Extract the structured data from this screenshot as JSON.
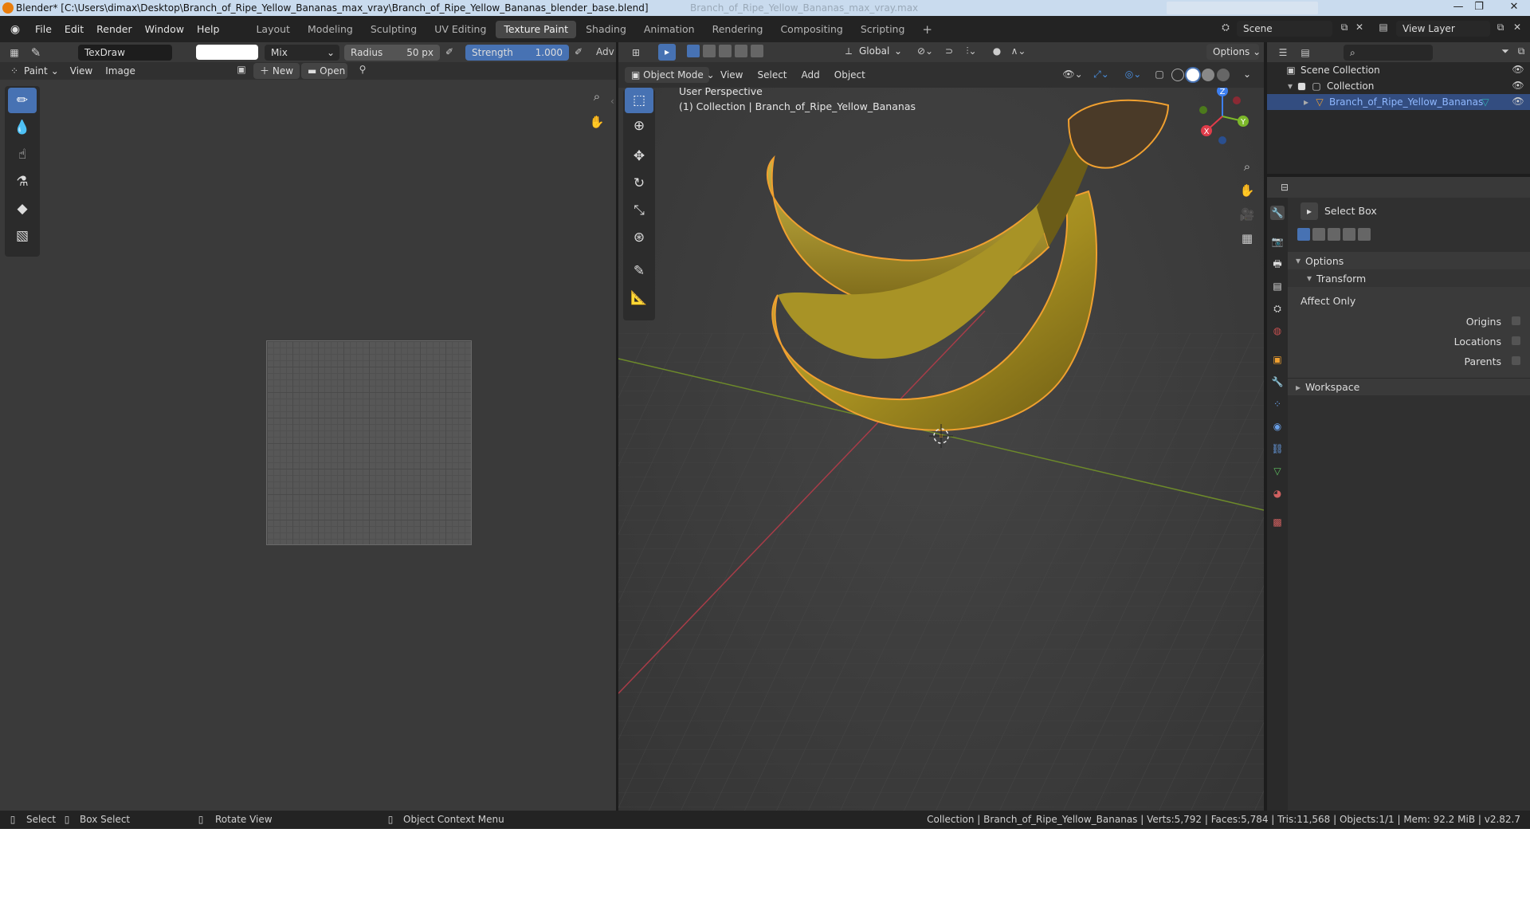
{
  "window": {
    "title": "Blender* [C:\\Users\\dimax\\Desktop\\Branch_of_Ripe_Yellow_Bananas_max_vray\\Branch_of_Ripe_Yellow_Bananas_blender_base.blend]",
    "ghost_text": "Branch_of_Ripe_Yellow_Bananas_max_vray.max"
  },
  "menu": [
    "File",
    "Edit",
    "Render",
    "Window",
    "Help"
  ],
  "workspaces": [
    {
      "label": "Layout"
    },
    {
      "label": "Modeling"
    },
    {
      "label": "Sculpting"
    },
    {
      "label": "UV Editing"
    },
    {
      "label": "Texture Paint",
      "active": true
    },
    {
      "label": "Shading"
    },
    {
      "label": "Animation"
    },
    {
      "label": "Rendering"
    },
    {
      "label": "Compositing"
    },
    {
      "label": "Scripting"
    }
  ],
  "add_workspace": "+",
  "scene": {
    "label": "Scene"
  },
  "view_layer": {
    "label": "View Layer"
  },
  "paint_header": {
    "brush_name": "TexDraw",
    "blend": "Mix",
    "radius_label": "Radius",
    "radius_value": "50 px",
    "strength_label": "Strength",
    "strength_value": "1.000",
    "more": "Adv"
  },
  "image_editor": {
    "mode": "Paint",
    "menus": [
      "View",
      "Image"
    ],
    "new_label": "New",
    "open_label": "Open"
  },
  "viewport": {
    "orientation": "Global",
    "options": "Options",
    "mode": "Object Mode",
    "menus": [
      "View",
      "Select",
      "Add",
      "Object"
    ],
    "overlay_line1": "User Perspective",
    "overlay_line2": "(1) Collection | Branch_of_Ripe_Yellow_Bananas",
    "gizmo": {
      "x": "X",
      "y": "Y",
      "z": "Z"
    }
  },
  "outliner": {
    "root": "Scene Collection",
    "collection": "Collection",
    "object": "Branch_of_Ripe_Yellow_Bananas"
  },
  "properties": {
    "tool_name": "Select Box",
    "options_label": "Options",
    "transform_label": "Transform",
    "affect_only_label": "Affect Only",
    "checks": [
      {
        "label": "Origins",
        "checked": false
      },
      {
        "label": "Locations",
        "checked": false
      },
      {
        "label": "Parents",
        "checked": false
      }
    ],
    "workspace_label": "Workspace"
  },
  "status": {
    "select": "Select",
    "box_select": "Box Select",
    "rotate": "Rotate View",
    "context": "Object Context Menu",
    "stats": "Collection | Branch_of_Ripe_Yellow_Bananas | Verts:5,792 | Faces:5,784 | Tris:11,568 | Objects:1/1 | Mem: 92.2 MiB | v2.82.7"
  },
  "colors": {
    "accent": "#4772b3",
    "selection_outline": "#f0a030",
    "banana": "#b8a02a"
  }
}
